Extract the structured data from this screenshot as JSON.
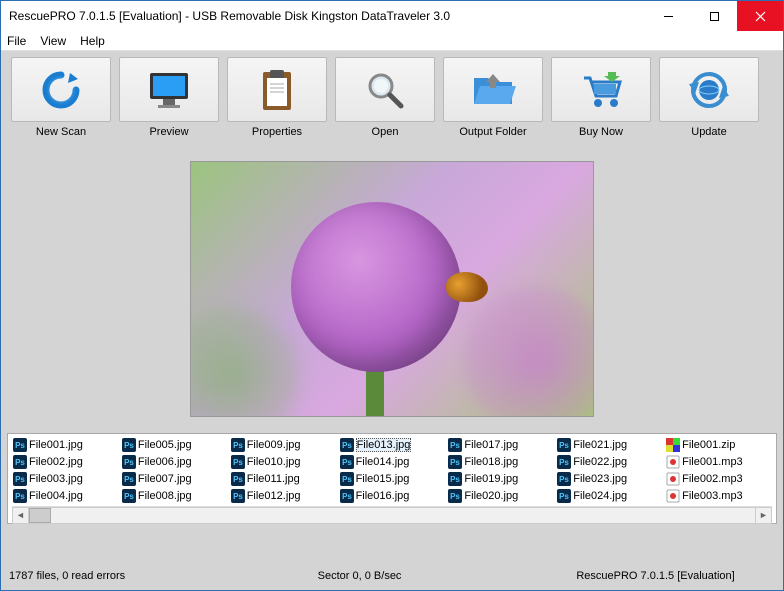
{
  "window": {
    "title": "RescuePRO 7.0.1.5 [Evaluation] - USB Removable Disk Kingston DataTraveler 3.0"
  },
  "menu": {
    "file": "File",
    "view": "View",
    "help": "Help"
  },
  "toolbar": {
    "new_scan": "New Scan",
    "preview": "Preview",
    "properties": "Properties",
    "open": "Open",
    "output_folder": "Output Folder",
    "buy_now": "Buy Now",
    "update": "Update"
  },
  "files": [
    {
      "name": "File001.jpg",
      "type": "ps"
    },
    {
      "name": "File002.jpg",
      "type": "ps"
    },
    {
      "name": "File003.jpg",
      "type": "ps"
    },
    {
      "name": "File004.jpg",
      "type": "ps"
    },
    {
      "name": "File005.jpg",
      "type": "ps"
    },
    {
      "name": "File006.jpg",
      "type": "ps"
    },
    {
      "name": "File007.jpg",
      "type": "ps"
    },
    {
      "name": "File008.jpg",
      "type": "ps"
    },
    {
      "name": "File009.jpg",
      "type": "ps"
    },
    {
      "name": "File010.jpg",
      "type": "ps"
    },
    {
      "name": "File011.jpg",
      "type": "ps"
    },
    {
      "name": "File012.jpg",
      "type": "ps"
    },
    {
      "name": "File013.jpg",
      "type": "ps",
      "selected": true
    },
    {
      "name": "File014.jpg",
      "type": "ps"
    },
    {
      "name": "File015.jpg",
      "type": "ps"
    },
    {
      "name": "File016.jpg",
      "type": "ps"
    },
    {
      "name": "File017.jpg",
      "type": "ps"
    },
    {
      "name": "File018.jpg",
      "type": "ps"
    },
    {
      "name": "File019.jpg",
      "type": "ps"
    },
    {
      "name": "File020.jpg",
      "type": "ps"
    },
    {
      "name": "File021.jpg",
      "type": "ps"
    },
    {
      "name": "File022.jpg",
      "type": "ps"
    },
    {
      "name": "File023.jpg",
      "type": "ps"
    },
    {
      "name": "File024.jpg",
      "type": "ps"
    },
    {
      "name": "File001.zip",
      "type": "zip"
    },
    {
      "name": "File001.mp3",
      "type": "mp3"
    },
    {
      "name": "File002.mp3",
      "type": "mp3"
    },
    {
      "name": "File003.mp3",
      "type": "mp3"
    }
  ],
  "status": {
    "left": "1787 files, 0 read errors",
    "center": "Sector 0, 0 B/sec",
    "right": "RescuePRO 7.0.1.5 [Evaluation]"
  }
}
